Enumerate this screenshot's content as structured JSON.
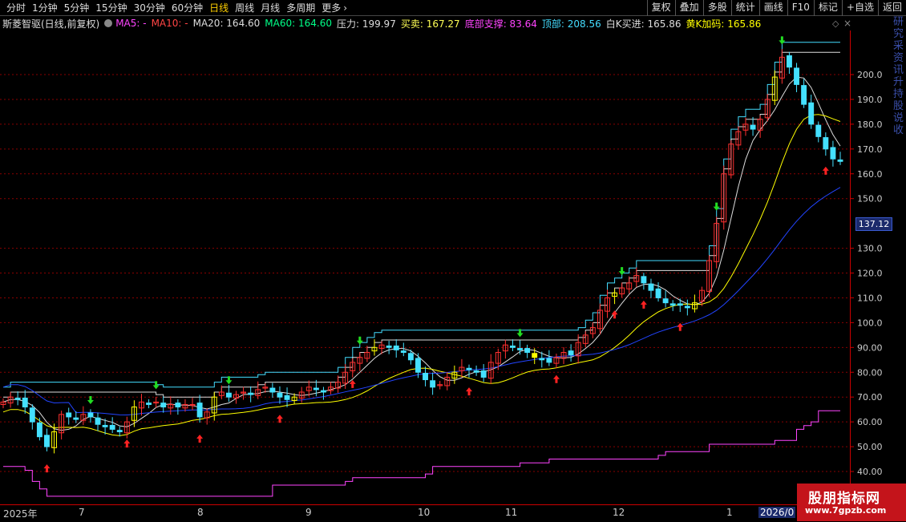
{
  "toolbar": {
    "periods": [
      "分时",
      "1分钟",
      "5分钟",
      "15分钟",
      "30分钟",
      "60分钟",
      "日线",
      "周线",
      "月线",
      "多周期",
      "更多"
    ],
    "active_period": "日线",
    "right_buttons": [
      "复权",
      "叠加",
      "多股",
      "统计",
      "画线",
      "F10",
      "标记",
      "+自选",
      "返回"
    ]
  },
  "infobar": {
    "stock_name": "斯菱智驱(日线,前复权)",
    "ma5": "MA5: -",
    "ma10": "MA10: -",
    "ma20": "MA20: 164.60",
    "ma60": "MA60: 164.60",
    "pressure": "压力: 199.97",
    "buysell": "买卖: 167.27",
    "bottom_support": "底部支撑: 83.64",
    "top": "顶部: 208.56",
    "white_k": "白K买进: 165.86",
    "yellow_k": "黄K加码: 165.86"
  },
  "colors": {
    "ma5": "#ff44ff",
    "ma10": "#ff4444",
    "ma20": "#dddddd",
    "ma60": "#00ff88",
    "pressure": "#dddddd",
    "buysell": "#ffff55",
    "bottom_support": "#ff44ff",
    "top": "#44ddff",
    "white_k": "#dddddd",
    "yellow_k": "#ffff00",
    "grid": "#8a0000",
    "up": "#ff3030",
    "down": "#44e0ff"
  },
  "price_axis": {
    "labels": [
      "200.0",
      "190.0",
      "180.0",
      "170.0",
      "160.0",
      "150.0",
      "130.0",
      "120.0",
      "110.0",
      "100.0",
      "90.00",
      "80.00",
      "70.00",
      "60.00",
      "50.00",
      "40.00"
    ],
    "current_price": "137.12"
  },
  "time_axis": [
    "2025年",
    "7",
    "8",
    "9",
    "10",
    "11",
    "12",
    "1",
    "2026/0"
  ],
  "sidebar_text": "研究 采 资讯 升 持 股 说 收",
  "watermark": {
    "title": "股朋指标网",
    "url": "www.7gpzb.com"
  },
  "chart_data": {
    "type": "candlestick",
    "ylim": [
      40,
      210
    ],
    "closes": [
      68,
      70,
      69,
      66,
      60,
      54,
      50,
      56,
      63,
      62,
      61,
      63,
      62,
      59,
      58,
      57,
      56,
      60,
      66,
      68,
      67,
      68,
      66,
      67,
      66,
      67,
      67,
      62,
      64,
      70,
      72,
      70,
      71,
      72,
      71,
      73,
      74,
      72,
      70,
      69,
      70,
      72,
      74,
      73,
      72,
      74,
      76,
      80,
      84,
      86,
      88,
      90,
      91,
      90,
      89,
      88,
      85,
      80,
      77,
      74,
      75,
      78,
      80,
      82,
      81,
      80,
      78,
      84,
      88,
      91,
      90,
      89,
      88,
      86,
      85,
      84,
      86,
      88,
      87,
      92,
      95,
      98,
      105,
      110,
      112,
      114,
      116,
      119,
      116,
      113,
      110,
      108,
      107,
      107,
      106,
      108,
      113,
      125,
      140,
      160,
      172,
      177,
      180,
      178,
      182,
      190,
      199,
      207,
      203,
      196,
      188,
      180,
      175,
      170,
      166,
      165
    ]
  }
}
